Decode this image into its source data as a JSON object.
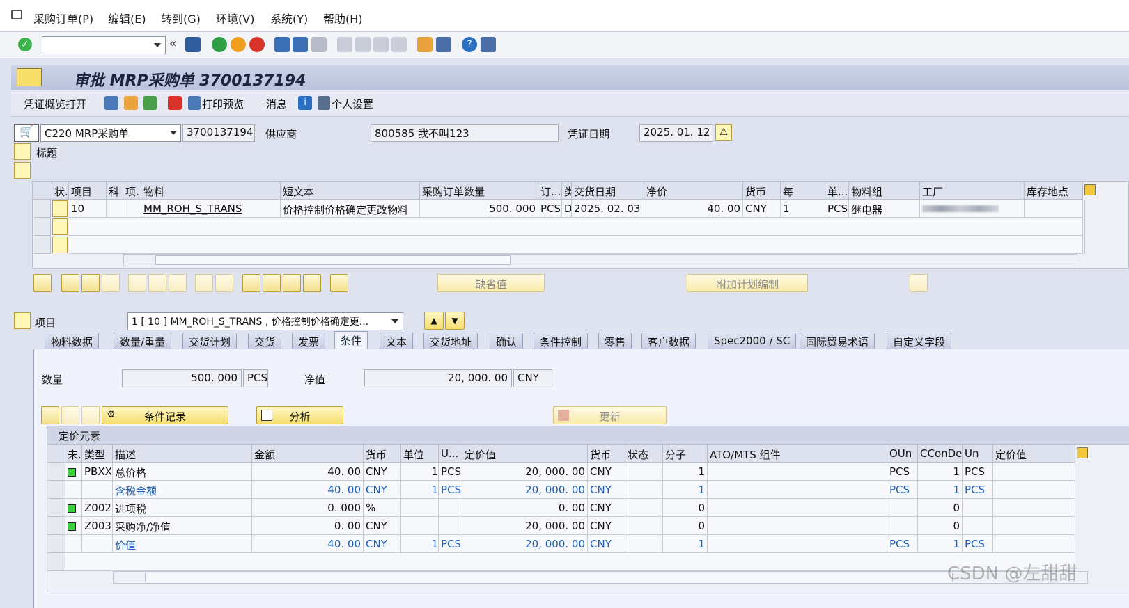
{
  "menu": [
    "采购订单(P)",
    "编辑(E)",
    "转到(G)",
    "环境(V)",
    "系统(Y)",
    "帮助(H)"
  ],
  "title": "审批 MRP采购单 3700137194",
  "app_toolbar": {
    "overview": "凭证概览打开",
    "print_preview": "打印预览",
    "messages": "消息",
    "personal": "个人设置"
  },
  "header": {
    "doc_type": "C220 MRP采购单",
    "po_number": "3700137194",
    "vendor_label": "供应商",
    "vendor": "800585 我不叫123",
    "date_label": "凭证日期",
    "date": "2025. 01. 12",
    "title_label": "标题"
  },
  "item_table": {
    "columns": [
      "状.",
      "项目",
      "科",
      "项.",
      "物料",
      "短文本",
      "采购订单数量",
      "订...",
      "类",
      "交货日期",
      "净价",
      "货币",
      "每",
      "单...",
      "物料组",
      "工厂",
      "库存地点"
    ],
    "rows": [
      {
        "item": "10",
        "material": "MM_ROH_S_TRANS",
        "short_text": "价格控制价格确定更改物料",
        "qty": "500. 000",
        "unit": "PCS",
        "cat": "D",
        "delivery_date": "2025. 02. 03",
        "net_price": "40. 00",
        "currency": "CNY",
        "per": "1",
        "order_unit": "PCS",
        "mat_group": "继电器"
      }
    ]
  },
  "buttons": {
    "default_values": "缺省值",
    "addl_planning": "附加计划编制",
    "cond_record": "条件记录",
    "analysis": "分析",
    "update": "更新"
  },
  "item_detail": {
    "label": "项目",
    "selector": "1 [ 10 ] MM_ROH_S_TRANS , 价格控制价格确定更..."
  },
  "tabs": [
    "物料数据",
    "数量/重量",
    "交货计划",
    "交货",
    "发票",
    "条件",
    "文本",
    "交货地址",
    "确认",
    "条件控制",
    "零售",
    "客户数据",
    "Spec2000 / SC",
    "国际贸易术语",
    "自定义字段"
  ],
  "active_tab": "条件",
  "conditions": {
    "qty_label": "数量",
    "qty": "500. 000",
    "qty_unit": "PCS",
    "net_label": "净值",
    "net": "20, 000. 00",
    "net_cur": "CNY",
    "section_title": "定价元素",
    "columns": [
      "未.",
      "类型",
      "描述",
      "金额",
      "货币",
      "单位",
      "U...",
      "定价值",
      "货币",
      "状态",
      "分子",
      "ATO/MTS 组件",
      "OUn",
      "CConDe",
      "Un",
      "定价值"
    ],
    "rows": [
      {
        "status": true,
        "type": "PBXX",
        "desc": "总价格",
        "amount": "40. 00",
        "cur": "CNY",
        "per": "1",
        "unit": "PCS",
        "value": "20, 000. 00",
        "vcur": "CNY",
        "num": "1",
        "oun": "PCS",
        "ccon": "1",
        "un": "PCS",
        "blue": false
      },
      {
        "status": false,
        "type": "",
        "desc": "含税金额",
        "amount": "40. 00",
        "cur": "CNY",
        "per": "1",
        "unit": "PCS",
        "value": "20, 000. 00",
        "vcur": "CNY",
        "num": "1",
        "oun": "PCS",
        "ccon": "1",
        "un": "PCS",
        "blue": true
      },
      {
        "status": true,
        "type": "Z002",
        "desc": "进项税",
        "amount": "0. 000",
        "cur": "%",
        "per": "",
        "unit": "",
        "value": "0. 00",
        "vcur": "CNY",
        "num": "0",
        "oun": "",
        "ccon": "0",
        "un": "",
        "blue": false
      },
      {
        "status": true,
        "type": "Z003",
        "desc": "采购净/净值",
        "amount": "0. 00",
        "cur": "CNY",
        "per": "",
        "unit": "",
        "value": "20, 000. 00",
        "vcur": "CNY",
        "num": "0",
        "oun": "",
        "ccon": "0",
        "un": "",
        "blue": false
      },
      {
        "status": false,
        "type": "",
        "desc": "价值",
        "amount": "40. 00",
        "cur": "CNY",
        "per": "1",
        "unit": "PCS",
        "value": "20, 000. 00",
        "vcur": "CNY",
        "num": "1",
        "oun": "PCS",
        "ccon": "1",
        "un": "PCS",
        "blue": true
      }
    ]
  },
  "watermark": "CSDN @左甜甜"
}
